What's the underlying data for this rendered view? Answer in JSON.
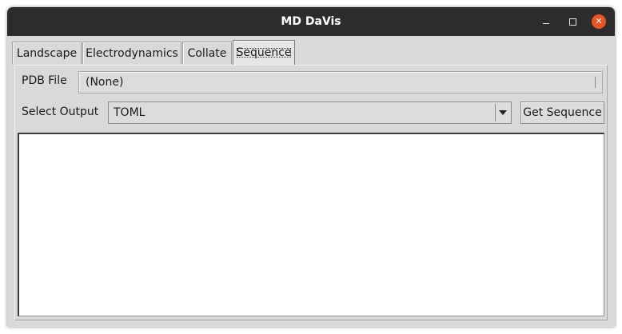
{
  "window": {
    "title": "MD DaVis",
    "close_glyph": "✕",
    "accent_close": "#e95420"
  },
  "tabs": [
    {
      "label": "Landscape",
      "active": false
    },
    {
      "label": "Electrodynamics",
      "active": false
    },
    {
      "label": "Collate",
      "active": false
    },
    {
      "label": "Sequence",
      "active": true
    }
  ],
  "sequence": {
    "pdb_label": "PDB File",
    "pdb_value": "(None)",
    "output_label": "Select Output",
    "output_selected": "TOML",
    "get_button": "Get Sequence",
    "output_text": ""
  }
}
